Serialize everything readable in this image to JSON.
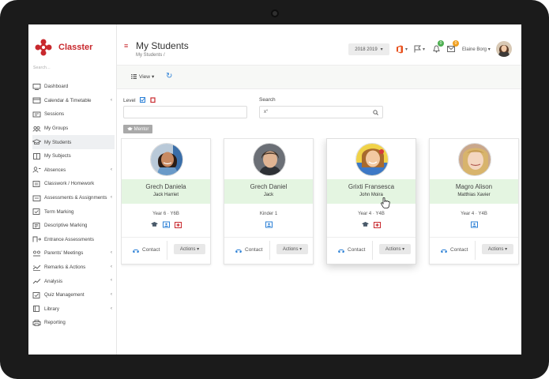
{
  "app": {
    "brand": "Classter",
    "search_label": "Search..."
  },
  "sidebar": {
    "items": [
      {
        "label": "Dashboard",
        "icon": "monitor-icon",
        "arrow": ""
      },
      {
        "label": "Calendar & Timetable",
        "icon": "calendar-icon",
        "arrow": "‹"
      },
      {
        "label": "Sessions",
        "icon": "sessions-icon",
        "arrow": ""
      },
      {
        "label": "My Groups",
        "icon": "groups-icon",
        "arrow": ""
      },
      {
        "label": "My Students",
        "icon": "students-icon",
        "arrow": ""
      },
      {
        "label": "My Subjects",
        "icon": "subjects-icon",
        "arrow": ""
      },
      {
        "label": "Absences",
        "icon": "absences-icon",
        "arrow": "‹"
      },
      {
        "label": "Classwork / Homework",
        "icon": "classwork-icon",
        "arrow": ""
      },
      {
        "label": "Assessments & Assignments",
        "icon": "assessments-icon",
        "arrow": "‹"
      },
      {
        "label": "Term Marking",
        "icon": "term-marking-icon",
        "arrow": ""
      },
      {
        "label": "Descriptive Marking",
        "icon": "descriptive-marking-icon",
        "arrow": ""
      },
      {
        "label": "Entrance Assessments",
        "icon": "entrance-icon",
        "arrow": ""
      },
      {
        "label": "Parents' Meetings",
        "icon": "meetings-icon",
        "arrow": "‹"
      },
      {
        "label": "Remarks & Actions",
        "icon": "remarks-icon",
        "arrow": "‹"
      },
      {
        "label": "Analysis",
        "icon": "analysis-icon",
        "arrow": "‹"
      },
      {
        "label": "Quiz Management",
        "icon": "quiz-icon",
        "arrow": "‹"
      },
      {
        "label": "Library",
        "icon": "library-icon",
        "arrow": "‹"
      },
      {
        "label": "Reporting",
        "icon": "reporting-icon",
        "arrow": ""
      }
    ],
    "active_index": 4
  },
  "header": {
    "menu_glyph": "≡",
    "title": "My Students",
    "breadcrumb": "My Students  /",
    "year": "2018 2019",
    "year_caret": "▾",
    "caret": "▾",
    "badge_notifications": "0",
    "badge_messages": "0",
    "user_name": "Elaine Borg"
  },
  "toolbar": {
    "view_label": "View",
    "view_caret": "▾",
    "refresh_glyph": "↻"
  },
  "filters": {
    "level_label": "Level",
    "search_label": "Search",
    "search_value": "x°",
    "chip_label": "Mentor"
  },
  "cards": [
    {
      "surname": "Grech Daniela",
      "guardian": "Jack Harriet",
      "year": "Year 6  ·  Y6B",
      "photo": "photo-girl-1",
      "icons": [
        "graduation-cap-icon",
        "id-card-icon",
        "medical-icon"
      ],
      "contact": "Contact",
      "actions": "Actions ▾"
    },
    {
      "surname": "Grech Daniel",
      "guardian": "Jack",
      "year": "Kinder 1",
      "photo": "photo-boy-1",
      "icons": [
        "id-card-icon"
      ],
      "contact": "Contact",
      "actions": "Actions ▾"
    },
    {
      "surname": "Grixti Fransesca",
      "guardian": "John Moira",
      "year": "Year 4  ·  Y4B",
      "photo": "photo-girl-2",
      "icons": [
        "graduation-cap-icon",
        "medical-icon"
      ],
      "contact": "Contact",
      "actions": "Actions ▾"
    },
    {
      "surname": "Magro Alison",
      "guardian": "Matthias Xavier",
      "year": "Year 4  ·  Y4B",
      "photo": "photo-girl-3",
      "icons": [
        "id-card-icon"
      ],
      "contact": "Contact",
      "actions": "Actions ▾"
    }
  ],
  "colors": {
    "brand_red": "#c8282d",
    "card_band_green": "#e4f5e1",
    "link_blue": "#2a7fd6"
  }
}
